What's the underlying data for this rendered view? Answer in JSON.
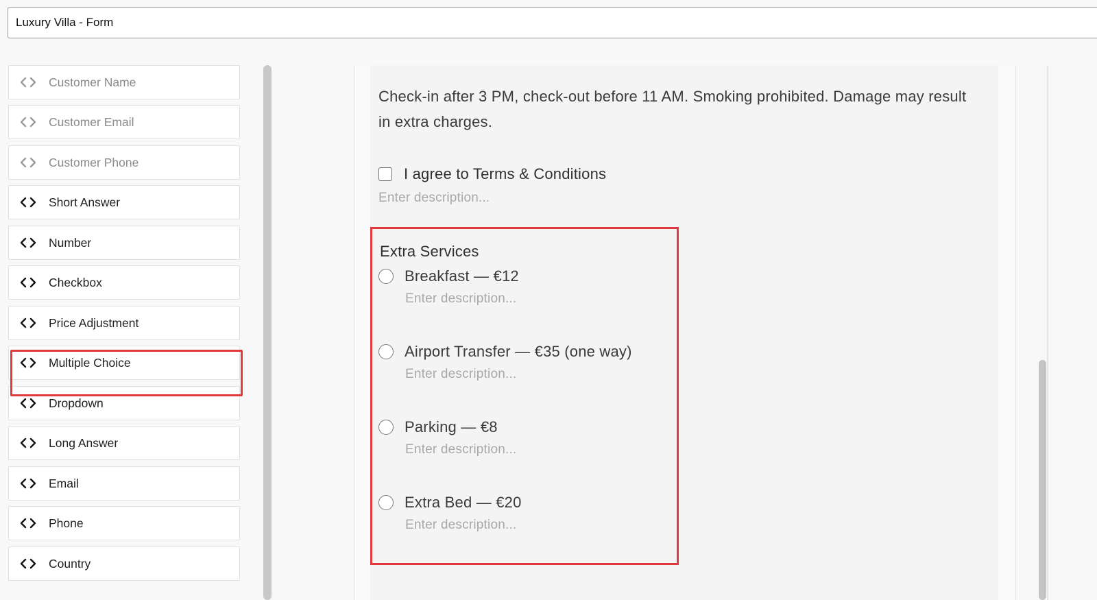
{
  "form": {
    "title": "Luxury Villa - Form"
  },
  "sidebar": {
    "items": [
      {
        "label": "Customer Name",
        "disabled": true
      },
      {
        "label": "Customer Email",
        "disabled": true
      },
      {
        "label": "Customer Phone",
        "disabled": true
      },
      {
        "label": "Short Answer",
        "disabled": false
      },
      {
        "label": "Number",
        "disabled": false
      },
      {
        "label": "Checkbox",
        "disabled": false
      },
      {
        "label": "Price Adjustment",
        "disabled": false
      },
      {
        "label": "Multiple Choice",
        "disabled": false
      },
      {
        "label": "Dropdown",
        "disabled": false
      },
      {
        "label": "Long Answer",
        "disabled": false
      },
      {
        "label": "Email",
        "disabled": false
      },
      {
        "label": "Phone",
        "disabled": false
      },
      {
        "label": "Country",
        "disabled": false
      }
    ],
    "item_icon": "code-brackets-icon"
  },
  "canvas": {
    "policy_text": "Check-in after 3 PM, check-out before 11 AM. Smoking prohibited. Damage may result in extra charges.",
    "terms": {
      "label": "I agree to Terms & Conditions",
      "description_placeholder": "Enter description..."
    },
    "multiple_choice": {
      "title": "Extra Services",
      "options": [
        {
          "label": "Breakfast — €12",
          "description_placeholder": "Enter description..."
        },
        {
          "label": "Airport Transfer — €35 (one way)",
          "description_placeholder": "Enter description..."
        },
        {
          "label": "Parking — €8",
          "description_placeholder": "Enter description..."
        },
        {
          "label": "Extra Bed — €20",
          "description_placeholder": "Enter description..."
        }
      ]
    }
  },
  "colors": {
    "highlight": "#e03a3e",
    "muted_text": "#a8a8a8"
  }
}
